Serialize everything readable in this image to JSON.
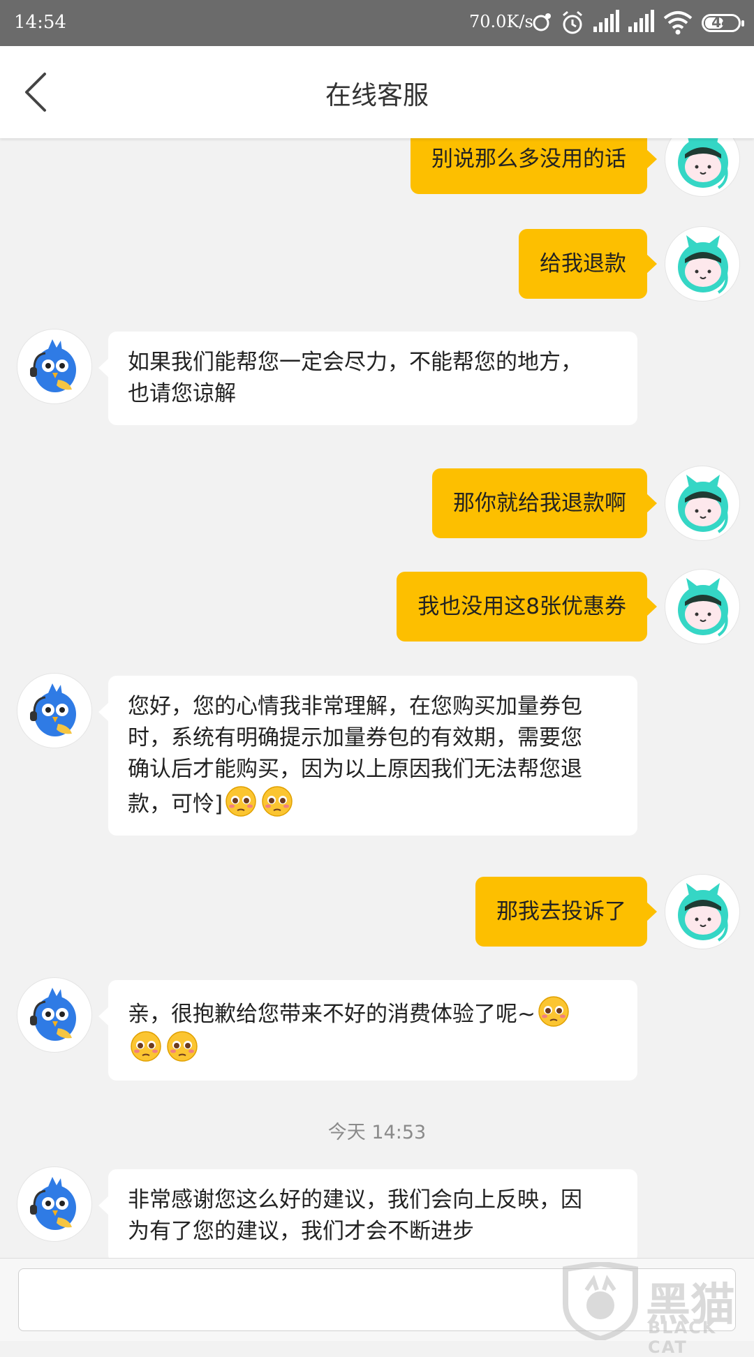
{
  "status_bar": {
    "time": "14:54",
    "network_speed": "70.0K/s",
    "battery": "44",
    "icons": [
      "sync-icon",
      "alarm-icon",
      "signal-icon",
      "signal-icon",
      "wifi-icon",
      "battery-icon"
    ]
  },
  "header": {
    "title": "在线客服",
    "back_icon": "chevron-left-icon"
  },
  "messages": [
    {
      "side": "right",
      "text": "别说那么多没用的话"
    },
    {
      "side": "right",
      "text": "给我退款"
    },
    {
      "side": "left",
      "lines": [
        "如果我们能帮您一定会尽力，不能帮您的地方，",
        "也请您谅解"
      ]
    },
    {
      "side": "right",
      "text": "那你就给我退款啊"
    },
    {
      "side": "right",
      "text": "我也没用这8张优惠券"
    },
    {
      "side": "left",
      "lines": [
        "您好，您的心情我非常理解，在您购买加量券包",
        "时，系统有明确提示加量券包的有效期，需要您",
        "确认后才能购买，因为以上原因我们无法帮您退",
        "款，可怜]"
      ]
    },
    {
      "side": "right",
      "text": "那我去投诉了"
    },
    {
      "side": "left",
      "lines": [
        "亲，很抱歉给您带来不好的消费体验了呢~"
      ]
    },
    {
      "side": "left",
      "lines": [
        "非常感谢您这么好的建议，我们会向上反映，因",
        "为有了您的建议，我们才会不断进步"
      ]
    }
  ],
  "timestamp": "今天 14:53",
  "watermark": {
    "text": "黑猫",
    "sub": "BLACK CAT"
  },
  "colors": {
    "outgoing_bubble": "#fdbf00",
    "incoming_bubble": "#ffffff",
    "background": "#f2f2f2",
    "status_bar": "#6b6b6b"
  }
}
